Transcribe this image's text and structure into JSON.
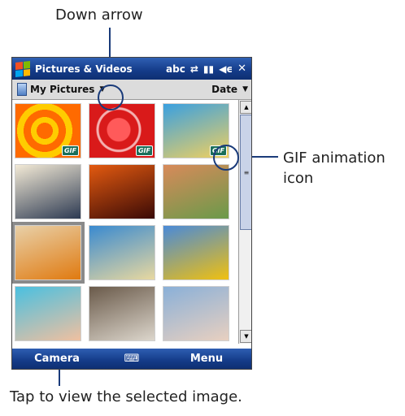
{
  "annotations": {
    "down_arrow": "Down arrow",
    "gif_icon": "GIF animation icon",
    "tap": "Tap to view the selected image."
  },
  "titlebar": {
    "title": "Pictures & Videos",
    "icons": [
      "windows-start-icon",
      "input-abc-icon",
      "connectivity-icon",
      "signal-icon",
      "volume-icon",
      "close-icon"
    ],
    "close_glyph": "✕"
  },
  "toolbar": {
    "folder": "My Pictures",
    "sort": "Date"
  },
  "thumbnails": [
    {
      "name": "target-rings",
      "gif": true,
      "colors": [
        "#ff6a00",
        "#ffcc00"
      ]
    },
    {
      "name": "red-heart",
      "gif": true,
      "colors": [
        "#d91a1a",
        "#ffffff"
      ]
    },
    {
      "name": "cartoon-doctor",
      "gif": true,
      "colors": [
        "#3aa0e0",
        "#f0d060"
      ]
    },
    {
      "name": "mountain-lake",
      "gif": false,
      "colors": [
        "#f3ead6",
        "#2d3a52"
      ]
    },
    {
      "name": "desert-sunset",
      "gif": false,
      "colors": [
        "#e35a10",
        "#3a0a06"
      ]
    },
    {
      "name": "mother-child",
      "gif": false,
      "colors": [
        "#d88a5a",
        "#6a9a4a"
      ]
    },
    {
      "name": "butterfly",
      "gif": false,
      "colors": [
        "#e8d0a8",
        "#e07a10"
      ]
    },
    {
      "name": "beach-palms",
      "gif": false,
      "colors": [
        "#3a8ad0",
        "#e8d8a0"
      ]
    },
    {
      "name": "sunflowers",
      "gif": false,
      "colors": [
        "#4a8ad8",
        "#f0c010"
      ]
    },
    {
      "name": "snorkel-couple",
      "gif": false,
      "colors": [
        "#4ac0e0",
        "#f0c0a0"
      ]
    },
    {
      "name": "husky-dog",
      "gif": false,
      "colors": [
        "#6a5a4a",
        "#dcd6cc"
      ]
    },
    {
      "name": "elderly-couple",
      "gif": false,
      "colors": [
        "#8ab0d8",
        "#e8d0c0"
      ]
    }
  ],
  "gif_badge": "GIF",
  "softkeys": {
    "left": "Camera",
    "right": "Menu",
    "keyboard_glyph": "⌨"
  },
  "accent": "#143b88"
}
